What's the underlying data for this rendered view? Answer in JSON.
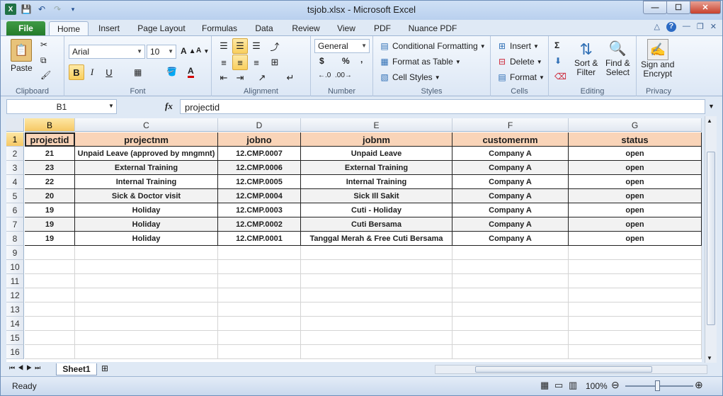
{
  "window": {
    "title": "tsjob.xlsx  -  Microsoft Excel"
  },
  "tabs": [
    "File",
    "Home",
    "Insert",
    "Page Layout",
    "Formulas",
    "Data",
    "Review",
    "View",
    "PDF",
    "Nuance PDF"
  ],
  "ribbon": {
    "clipboard": {
      "paste": "Paste",
      "label": "Clipboard"
    },
    "font": {
      "name": "Arial",
      "size": "10",
      "bold": "B",
      "italic": "I",
      "underline": "U",
      "label": "Font"
    },
    "alignment": {
      "label": "Alignment"
    },
    "number": {
      "format": "General",
      "currency": "$",
      "percent": "%",
      "comma": ",",
      "label": "Number"
    },
    "styles": {
      "conditional": "Conditional Formatting",
      "table": "Format as Table",
      "cell": "Cell Styles",
      "label": "Styles"
    },
    "cells": {
      "insert": "Insert",
      "delete": "Delete",
      "format": "Format",
      "label": "Cells"
    },
    "editing": {
      "sigma": "Σ",
      "sort1": "Sort &",
      "sort2": "Filter",
      "find1": "Find &",
      "find2": "Select",
      "label": "Editing"
    },
    "privacy": {
      "sign1": "Sign and",
      "sign2": "Encrypt",
      "label": "Privacy"
    }
  },
  "formula": {
    "namebox": "B1",
    "fx": "fx",
    "content": "projectid"
  },
  "columns": [
    "B",
    "C",
    "D",
    "E",
    "F",
    "G"
  ],
  "rows": [
    "1",
    "2",
    "3",
    "4",
    "5",
    "6",
    "7",
    "8",
    "9",
    "10",
    "11",
    "12",
    "13",
    "14",
    "15",
    "16"
  ],
  "header": [
    "projectid",
    "projectnm",
    "jobno",
    "jobnm",
    "customernm",
    "status"
  ],
  "data": [
    [
      "21",
      "Unpaid Leave (approved by mngmnt)",
      "12.CMP.0007",
      "Unpaid Leave",
      "Company A",
      "open"
    ],
    [
      "23",
      "External Training",
      "12.CMP.0006",
      "External Training",
      "Company A",
      "open"
    ],
    [
      "22",
      "Internal Training",
      "12.CMP.0005",
      "Internal Training",
      "Company A",
      "open"
    ],
    [
      "20",
      "Sick & Doctor visit",
      "12.CMP.0004",
      "Sick Ill Sakit",
      "Company A",
      "open"
    ],
    [
      "19",
      "Holiday",
      "12.CMP.0003",
      "Cuti - Holiday",
      "Company A",
      "open"
    ],
    [
      "19",
      "Holiday",
      "12.CMP.0002",
      "Cuti Bersama",
      "Company A",
      "open"
    ],
    [
      "19",
      "Holiday",
      "12.CMP.0001",
      "Tanggal Merah & Free Cuti Bersama",
      "Company A",
      "open"
    ]
  ],
  "sheet": {
    "name": "Sheet1"
  },
  "status": {
    "ready": "Ready",
    "zoom": "100%"
  },
  "colors": {
    "header_fill": "#f9d4b8",
    "file_tab": "#2e8b34",
    "selection": "#f6c864"
  }
}
